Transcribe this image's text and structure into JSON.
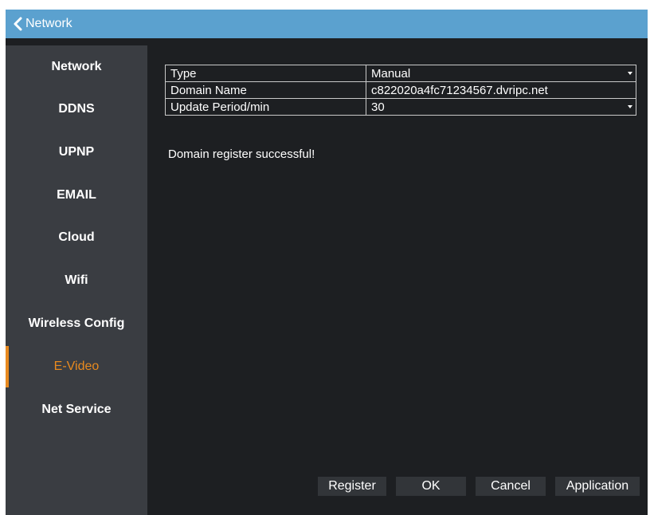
{
  "header": {
    "back_label": "Network",
    "accent": "#5ba1cf"
  },
  "sidebar": {
    "active_color": "#e88a1f",
    "items": [
      {
        "label": "Network"
      },
      {
        "label": "DDNS"
      },
      {
        "label": "UPNP"
      },
      {
        "label": "EMAIL"
      },
      {
        "label": "Cloud"
      },
      {
        "label": "Wifi"
      },
      {
        "label": "Wireless Config"
      },
      {
        "label": "E-Video",
        "active": true
      },
      {
        "label": "Net Service"
      }
    ]
  },
  "form": {
    "rows": [
      {
        "label": "Type",
        "value": "Manual",
        "control": "dropdown"
      },
      {
        "label": "Domain Name",
        "value": "c822020a4fc71234567.dvripc.net",
        "control": "text"
      },
      {
        "label": "Update Period/min",
        "value": "30",
        "control": "dropdown"
      }
    ]
  },
  "status_message": "Domain register successful!",
  "buttons": {
    "register": "Register",
    "ok": "OK",
    "cancel": "Cancel",
    "application": "Application"
  }
}
